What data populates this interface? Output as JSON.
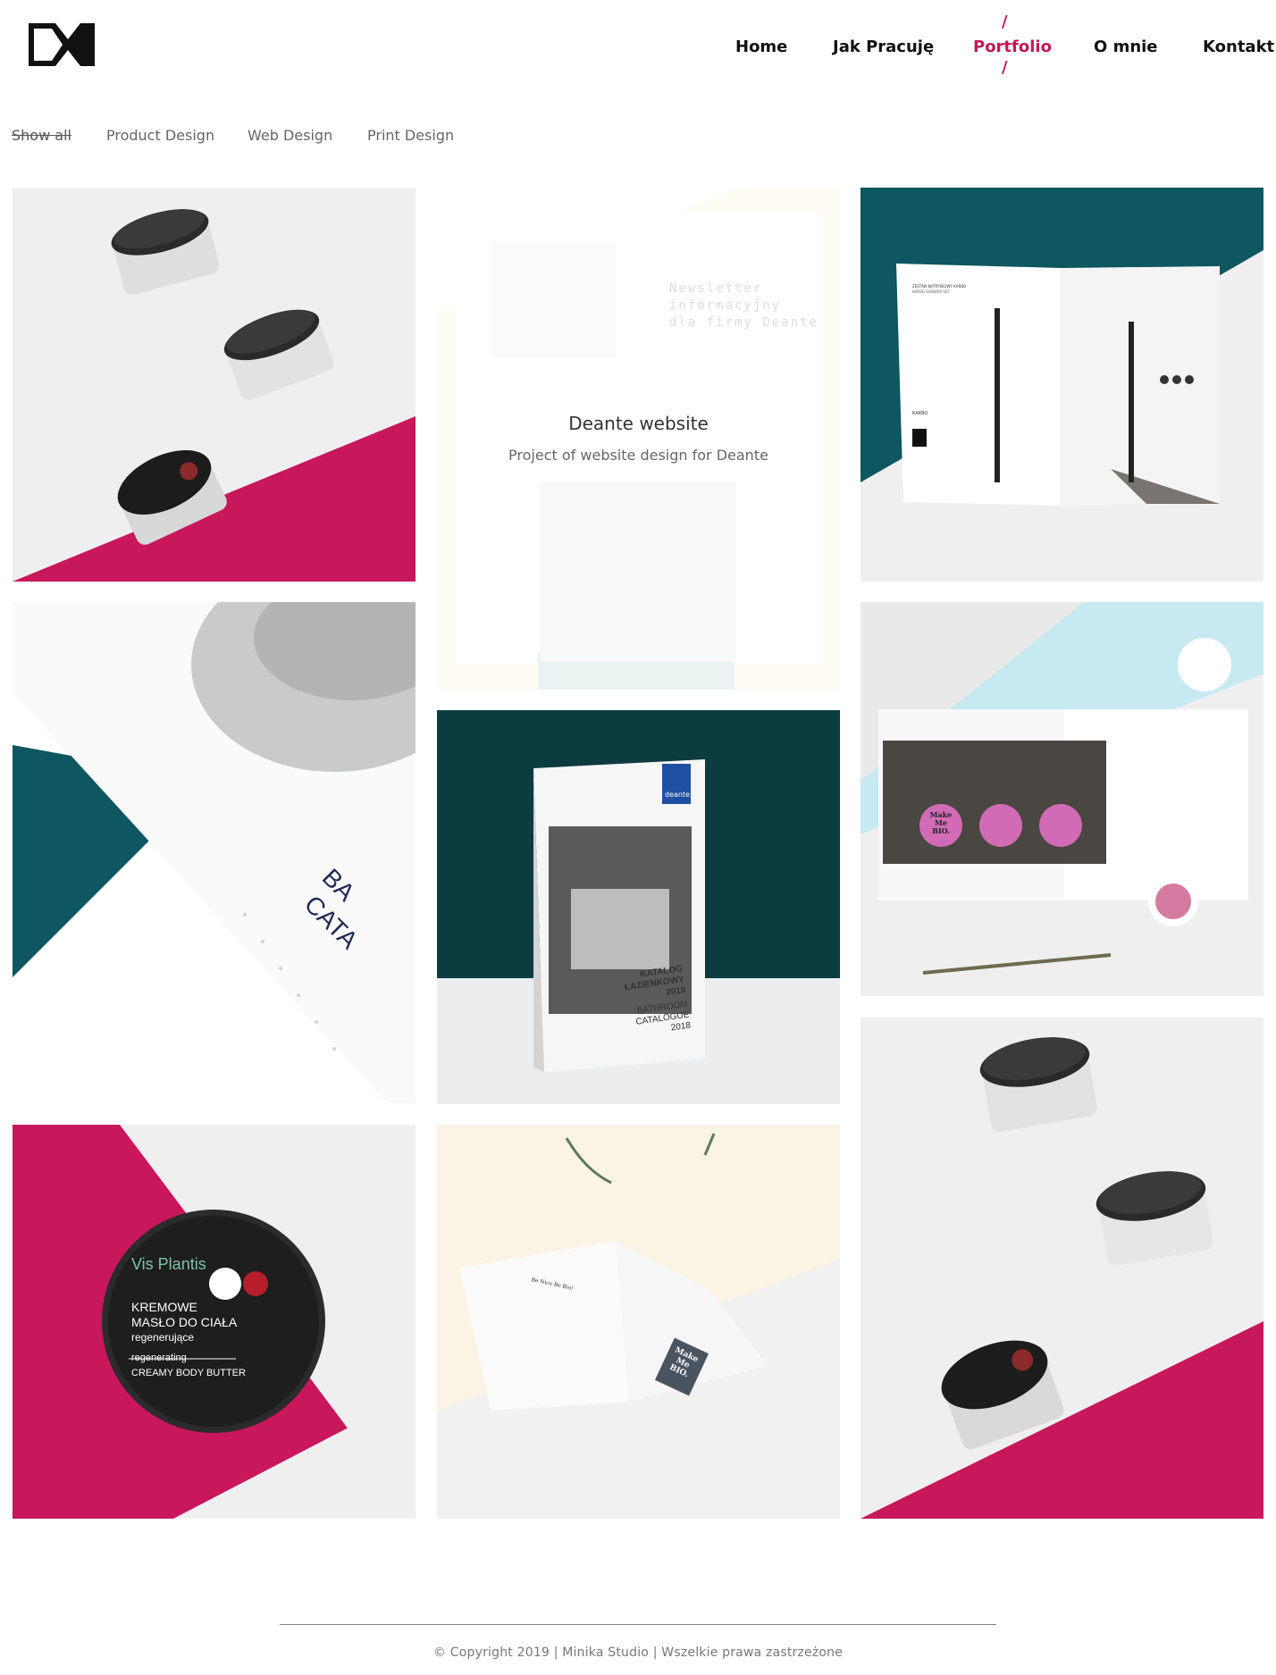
{
  "nav": {
    "home": "Home",
    "jak_pracuje": "Jak Pracuję",
    "portfolio": "Portfolio",
    "o_mnie": "O mnie",
    "kontakt": "Kontakt",
    "active_color": "#c2185b"
  },
  "filters": {
    "show_all": "Show all",
    "product_design": "Product Design",
    "web_design": "Web Design",
    "print_design": "Print Design"
  },
  "tiles": {
    "deante_web": {
      "title": "Deante website",
      "subtitle": "Project of website design for Deante",
      "newsletter_line1": "Newsletter",
      "newsletter_line2": "informacyjny",
      "newsletter_line3": "dla firmy Deante"
    },
    "catalog": {
      "brand": "deante",
      "title_line1": "KATALOG",
      "title_line2": "ŁAZIENKOWY",
      "title_line3": "2018",
      "sub_line1": "BATHROOM",
      "sub_line2": "CATALOGUE",
      "sub_line3": "2018"
    },
    "butter_closeup": {
      "brand": "Vis Plantis",
      "line1": "KREMOWE",
      "line2": "MASŁO DO CIAŁA",
      "line3": "regenerujące",
      "line4": "regenerating",
      "line5": "CREAMY BODY BUTTER"
    },
    "makemebio_jar": {
      "line1": "Make",
      "line2": "Me",
      "line3": "BIO."
    },
    "folder": {
      "brand_line1": "Make",
      "brand_line2": "Me",
      "brand_line3": "BIO.",
      "tagline": "Be Nice Be Bio!"
    },
    "booklet": {
      "line1": "ZESTAW NATRYSKOWY KARBO",
      "line2": "KARBO SHOWER SET",
      "line3": "KARBO"
    }
  },
  "colors": {
    "magenta": "#c2185b",
    "teal": "#0e5660",
    "dark_teal": "#0c3b40",
    "light_blue": "#c7e9f2",
    "cream": "#fbe6b9",
    "jar_black": "#222222"
  },
  "footer": {
    "copyright": "© Copyright 2019 | Minika Studio | Wszelkie prawa zastrzeżone"
  }
}
